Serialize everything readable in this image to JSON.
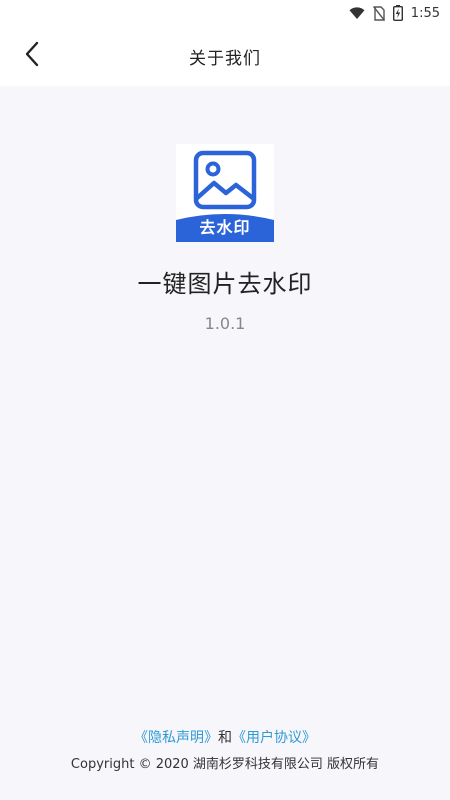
{
  "status_bar": {
    "time": "1:55",
    "icons": [
      "wifi-icon",
      "no-sim-icon",
      "battery-charging-icon"
    ]
  },
  "app_bar": {
    "back_icon": "chevron-left-icon",
    "title": "关于我们"
  },
  "about": {
    "icon_name": "image-watermark-app-icon",
    "icon_badge_text": "去水印",
    "icon_color": "#2b63d9",
    "app_name": "一键图片去水印",
    "version": "1.0.1"
  },
  "footer": {
    "privacy_link": "《隐私声明》",
    "conjunction": "和",
    "agreement_link": "《用户协议》",
    "link_color": "#2f9bd6",
    "copyright": "Copyright © 2020 湖南杉罗科技有限公司 版权所有"
  }
}
